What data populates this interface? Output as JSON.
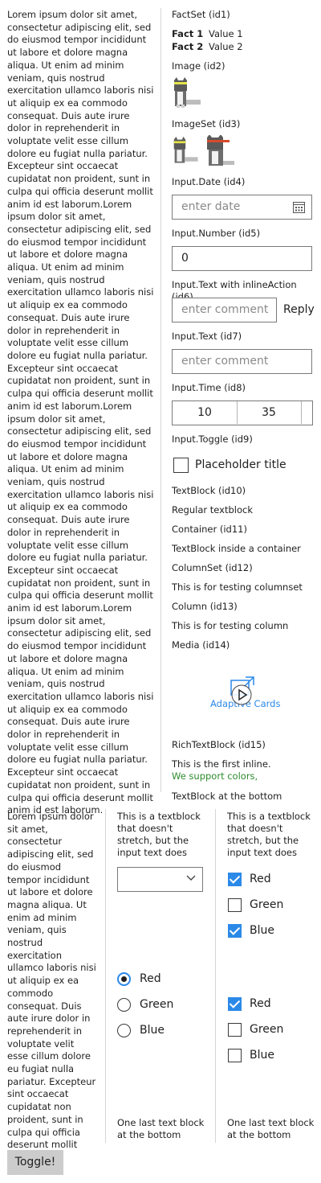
{
  "lorem_long": "Lorem ipsum dolor sit amet, consectetur adipiscing elit, sed do eiusmod tempor incididunt ut labore et dolore magna aliqua. Ut enim ad minim veniam, quis nostrud exercitation ullamco laboris nisi ut aliquip ex ea commodo consequat. Duis aute irure dolor in reprehenderit in voluptate velit esse cillum dolore eu fugiat nulla pariatur. Excepteur sint occaecat cupidatat non proident, sunt in culpa qui officia deserunt mollit anim id est laborum.Lorem ipsum dolor sit amet, consectetur adipiscing elit, sed do eiusmod tempor incididunt ut labore et dolore magna aliqua. Ut enim ad minim veniam, quis nostrud exercitation ullamco laboris nisi ut aliquip ex ea commodo consequat. Duis aute irure dolor in reprehenderit in voluptate velit esse cillum dolore eu fugiat nulla pariatur. Excepteur sint occaecat cupidatat non proident, sunt in culpa qui officia deserunt mollit anim id est laborum.Lorem ipsum dolor sit amet, consectetur adipiscing elit, sed do eiusmod tempor incididunt ut labore et dolore magna aliqua. Ut enim ad minim veniam, quis nostrud exercitation ullamco laboris nisi ut aliquip ex ea commodo consequat. Duis aute irure dolor in reprehenderit in voluptate velit esse cillum dolore eu fugiat nulla pariatur. Excepteur sint occaecat cupidatat non proident, sunt in culpa qui officia deserunt mollit anim id est laborum.Lorem ipsum dolor sit amet, consectetur adipiscing elit, sed do eiusmod tempor incididunt ut labore et dolore magna aliqua. Ut enim ad minim veniam, quis nostrud exercitation ullamco laboris nisi ut aliquip ex ea commodo consequat. Duis aute irure dolor in reprehenderit in voluptate velit esse cillum dolore eu fugiat nulla pariatur. Excepteur sint occaecat cupidatat non proident, sunt in culpa qui officia deserunt mollit anim id est laborum.",
  "lorem_short": "Lorem ipsum dolor sit amet, consectetur adipiscing elit, sed do eiusmod tempor incididunt ut labore et dolore magna aliqua. Ut enim ad minim veniam, quis nostrud exercitation ullamco laboris nisi ut aliquip ex ea commodo consequat. Duis aute irure dolor in reprehenderit in voluptate velit esse cillum dolore eu fugiat nulla pariatur. Excepteur sint occaecat cupidatat non proident, sunt in culpa qui officia deserunt mollit anim id est laborum.",
  "factset": {
    "label": "FactSet (id1)",
    "facts": [
      {
        "title": "Fact 1",
        "value": "Value 1"
      },
      {
        "title": "Fact 2",
        "value": "Value 2"
      }
    ]
  },
  "image_label": "Image (id2)",
  "imageset_label": "ImageSet (id3)",
  "date": {
    "label": "Input.Date (id4)",
    "placeholder": "enter date"
  },
  "number": {
    "label": "Input.Number (id5)",
    "value": "0"
  },
  "inline_action": {
    "label": "Input.Text with inlineAction (id6)",
    "placeholder": "enter comment",
    "action": "Reply"
  },
  "text_input": {
    "label": "Input.Text (id7)",
    "placeholder": "enter comment"
  },
  "time": {
    "label": "Input.Time (id8)",
    "hour": "10",
    "minute": "35"
  },
  "toggle": {
    "label": "Input.Toggle (id9)",
    "title": "Placeholder title"
  },
  "textblock": {
    "label": "TextBlock (id10)",
    "text": "Regular textblock"
  },
  "container": {
    "label": "Container (id11)",
    "text": "TextBlock inside a container"
  },
  "columnset": {
    "label": "ColumnSet (id12)",
    "text": "This is for testing columnset"
  },
  "column": {
    "label": "Column (id13)",
    "text": "This is for testing column"
  },
  "media": {
    "label": "Media (id14)",
    "poster_text": "Adaptive Cards"
  },
  "richtext": {
    "label": "RichTextBlock (id15)",
    "plain": "This is the first inline.",
    "colored": "We support colors,",
    "color": "#2e8b2e"
  },
  "bottom_text": "TextBlock at the bottom",
  "col_header": "This is a textblock that doesn't stretch, but the input text does",
  "choices": [
    "Red",
    "Green",
    "Blue"
  ],
  "last_text": "One last text block at the bottom",
  "toggle_button": "Toggle!",
  "colors": {
    "accent": "#2b89e8",
    "divider": "#d6d6d6"
  }
}
